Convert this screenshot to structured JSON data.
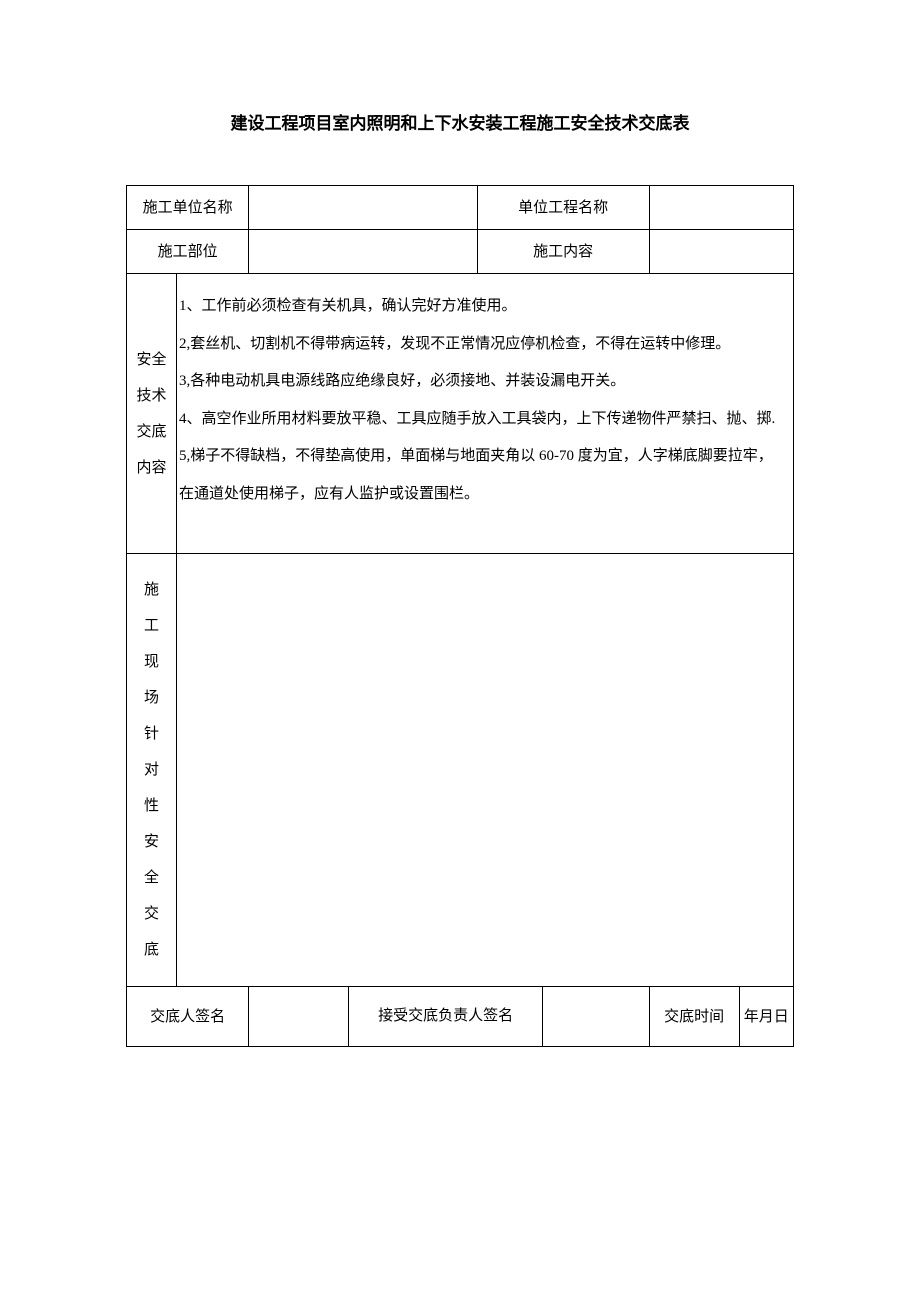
{
  "title": "建设工程项目室内照明和上下水安装工程施工安全技术交底表",
  "labels": {
    "constructionUnit": "施工单位名称",
    "projectName": "单位工程名称",
    "constructionPart": "施工部位",
    "constructionContent": "施工内容",
    "safetyContent": "安全技术交底内容",
    "siteSafety": "施工现场针对性安全交底",
    "signerName": "交底人签名",
    "receiverName": "接受交底负责人签名",
    "time": "交底时间",
    "date": "年月日"
  },
  "content": {
    "line1": "1、工作前必须检查有关机具，确认完好方准使用。",
    "line2": "2,套丝机、切割机不得带病运转，发现不正常情况应停机检查，不得在运转中修理。",
    "line3": "3,各种电动机具电源线路应绝缘良好，必须接地、并装设漏电开关。",
    "line4": "4、高空作业所用材料要放平稳、工具应随手放入工具袋内，上下传递物件严禁扫、抛、掷.",
    "line5": "5,梯子不得缺档，不得垫高使用，单面梯与地面夹角以 60-70 度为宜，人字梯底脚要拉牢，在通道处使用梯子，应有人监护或设置围栏。"
  }
}
